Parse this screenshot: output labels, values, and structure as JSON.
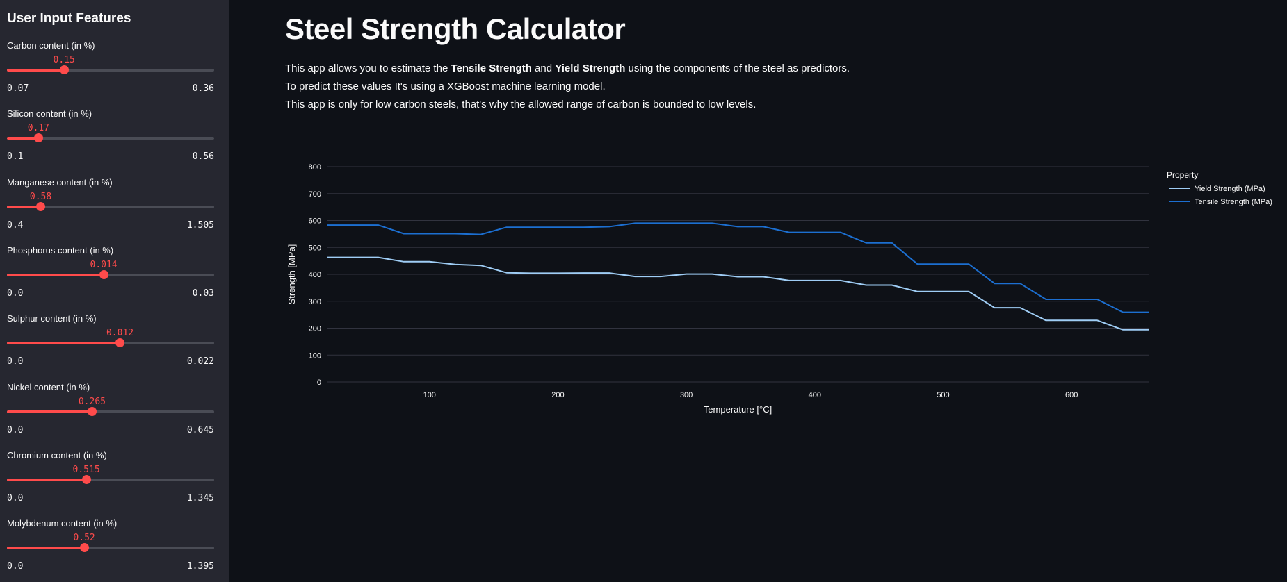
{
  "sidebar": {
    "title": "User Input Features",
    "sliders": [
      {
        "label": "Carbon content (in %)",
        "min_label": "0.07",
        "max_label": "0.36",
        "min": 0.07,
        "max": 0.36,
        "value": 0.15,
        "value_label": "0.15"
      },
      {
        "label": "Silicon content (in %)",
        "min_label": "0.1",
        "max_label": "0.56",
        "min": 0.1,
        "max": 0.56,
        "value": 0.17,
        "value_label": "0.17"
      },
      {
        "label": "Manganese content (in %)",
        "min_label": "0.4",
        "max_label": "1.505",
        "min": 0.4,
        "max": 1.505,
        "value": 0.58,
        "value_label": "0.58"
      },
      {
        "label": "Phosphorus content (in %)",
        "min_label": "0.0",
        "max_label": "0.03",
        "min": 0.0,
        "max": 0.03,
        "value": 0.014,
        "value_label": "0.014"
      },
      {
        "label": "Sulphur content (in %)",
        "min_label": "0.0",
        "max_label": "0.022",
        "min": 0.0,
        "max": 0.022,
        "value": 0.012,
        "value_label": "0.012"
      },
      {
        "label": "Nickel content (in %)",
        "min_label": "0.0",
        "max_label": "0.645",
        "min": 0.0,
        "max": 0.645,
        "value": 0.265,
        "value_label": "0.265"
      },
      {
        "label": "Chromium content (in %)",
        "min_label": "0.0",
        "max_label": "1.345",
        "min": 0.0,
        "max": 1.345,
        "value": 0.515,
        "value_label": "0.515"
      },
      {
        "label": "Molybdenum content (in %)",
        "min_label": "0.0",
        "max_label": "1.395",
        "min": 0.0,
        "max": 1.395,
        "value": 0.52,
        "value_label": "0.52"
      }
    ]
  },
  "main": {
    "title": "Steel Strength Calculator",
    "desc1": {
      "a": "This app allows you to estimate the ",
      "b": "Tensile Strength",
      "c": " and ",
      "d": "Yield Strength",
      "e": " using the components of the steel as predictors."
    },
    "desc2": "To predict these values It's using a XGBoost machine learning model.",
    "desc3": "This app is only for low carbon steels, that's why the allowed range of carbon is bounded to low levels."
  },
  "colors": {
    "accent": "#ff4b4b",
    "background": "#0e1117",
    "sidebar": "#262730",
    "yield_line": "#9fcdf5",
    "tensile_line": "#1c6fd1"
  },
  "chart_data": {
    "type": "line",
    "xlabel": "Temperature [°C]",
    "ylabel": "Strength [MPa]",
    "xlim": [
      20,
      660
    ],
    "ylim": [
      0,
      800
    ],
    "xticks": [
      100,
      200,
      300,
      400,
      500,
      600
    ],
    "yticks": [
      0,
      100,
      200,
      300,
      400,
      500,
      600,
      700,
      800
    ],
    "grid": true,
    "legend_title": "Property",
    "legend_position": "right",
    "x": [
      20,
      40,
      60,
      80,
      100,
      120,
      140,
      160,
      180,
      200,
      220,
      240,
      260,
      280,
      300,
      320,
      340,
      360,
      380,
      400,
      420,
      440,
      460,
      480,
      500,
      520,
      540,
      560,
      580,
      600,
      620,
      640,
      660
    ],
    "series": [
      {
        "name": "Yield Strength (MPa)",
        "color": "#9fcdf5",
        "values": [
          463,
          463,
          463,
          447,
          447,
          437,
          433,
          406,
          404,
          404,
          405,
          405,
          392,
          392,
          401,
          401,
          391,
          391,
          377,
          377,
          377,
          360,
          360,
          336,
          336,
          336,
          276,
          276,
          229,
          229,
          229,
          194,
          194
        ]
      },
      {
        "name": "Tensile Strength (MPa)",
        "color": "#1c6fd1",
        "values": [
          583,
          583,
          583,
          551,
          551,
          551,
          548,
          575,
          575,
          575,
          575,
          577,
          590,
          590,
          590,
          590,
          577,
          577,
          556,
          556,
          556,
          517,
          517,
          438,
          438,
          438,
          366,
          366,
          307,
          307,
          307,
          259,
          259
        ]
      }
    ]
  }
}
